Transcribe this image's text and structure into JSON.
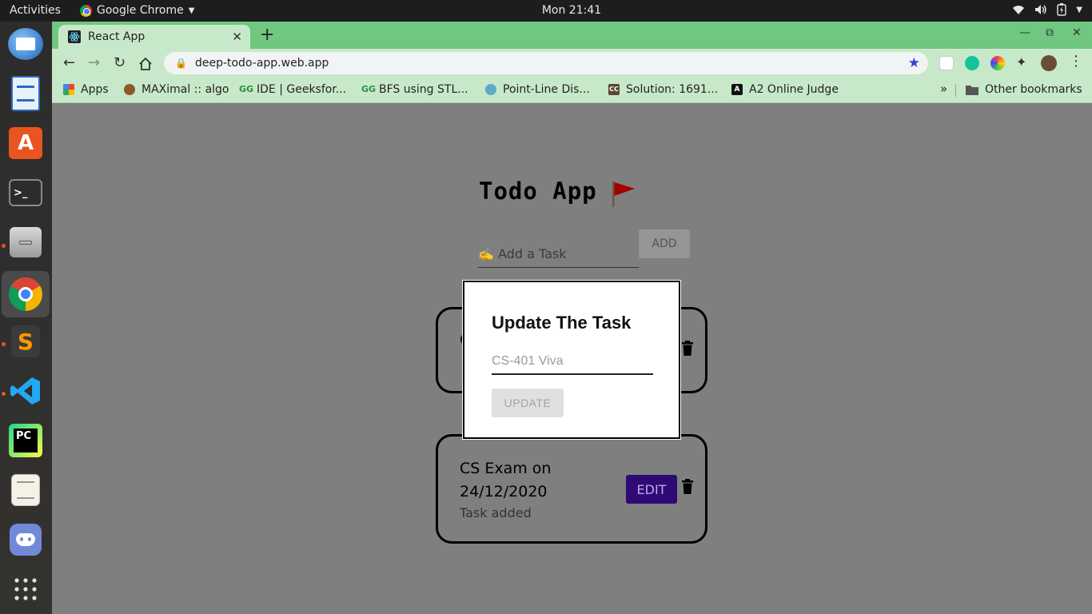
{
  "topbar": {
    "activities": "Activities",
    "app_name": "Google Chrome",
    "clock": "Mon 21:41"
  },
  "dock": {
    "items": [
      "thunderbird-icon",
      "writer-icon",
      "software-center-icon",
      "terminal-icon",
      "files-icon",
      "chrome-icon",
      "sublime-text-icon",
      "vscode-icon",
      "pycharm-icon",
      "text-editor-icon",
      "discord-icon",
      "show-apps-icon"
    ]
  },
  "browser": {
    "tab_title": "React App",
    "url": "deep-todo-app.web.app",
    "bookmarks": [
      "Apps",
      "MAXimal :: algo",
      "IDE | Geeksfor...",
      "BFS using STL...",
      "Point-Line Dis...",
      "Solution: 1691...",
      "A2 Online Judge"
    ],
    "overflow": "»",
    "other_bookmarks": "Other bookmarks",
    "colors": {
      "frame": "#70c780",
      "toolbar": "#c8e9c9"
    }
  },
  "app": {
    "title": "Todo App",
    "input_placeholder": "✍️ Add a Task",
    "add_label": "ADD",
    "tasks": [
      {
        "letter": "C",
        "text": "",
        "sub": ""
      },
      {
        "text": "CS Exam on 24/12/2020",
        "sub": "Task added",
        "edit_label": "EDIT"
      }
    ],
    "colors": {
      "edit_button": "#2d0a75"
    }
  },
  "modal": {
    "title": "Update The Task",
    "input_placeholder": "CS-401 Viva",
    "update_label": "UPDATE"
  }
}
